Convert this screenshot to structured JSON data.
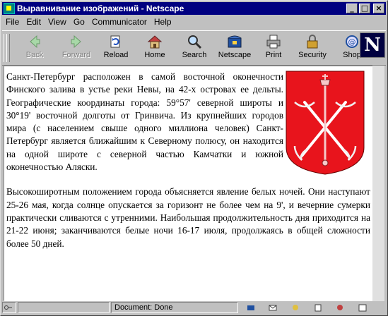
{
  "window": {
    "title": "Выравнивание изображений - Netscape",
    "minimize_glyph": "_",
    "maximize_glyph": "□",
    "close_glyph": "×"
  },
  "menu": [
    "File",
    "Edit",
    "View",
    "Go",
    "Communicator",
    "Help"
  ],
  "toolbar": {
    "buttons": [
      {
        "label": "Back",
        "icon": "back-arrow-icon",
        "enabled": false
      },
      {
        "label": "Forward",
        "icon": "forward-arrow-icon",
        "enabled": false
      },
      {
        "label": "Reload",
        "icon": "reload-icon",
        "enabled": true
      },
      {
        "label": "Home",
        "icon": "home-icon",
        "enabled": true
      },
      {
        "label": "Search",
        "icon": "search-icon",
        "enabled": true
      },
      {
        "label": "Netscape",
        "icon": "netscape-icon",
        "enabled": true
      },
      {
        "label": "Print",
        "icon": "print-icon",
        "enabled": true
      },
      {
        "label": "Security",
        "icon": "security-lock-icon",
        "enabled": true
      },
      {
        "label": "Shop",
        "icon": "shop-icon",
        "enabled": true
      }
    ],
    "logo_letter": "N"
  },
  "content": {
    "paragraph1": "Санкт-Петербург расположен в самой восточной оконечности Финского залива в устье реки Невы, на 42-х островах ее дельты. Географические координаты города: 59°57' северной широты и 30°19' восточной долготы от Гринвича. Из крупнейших городов мира (с населением свыше одного миллиона человек) Санкт-Петербург является ближайшим к Северному полюсу, он находится на одной широте с северной частью Камчатки и южной оконечностью Аляски.",
    "paragraph2": "Высокоширотным положением города объясняется явление белых ночей. Они наступают 25-26 мая, когда солнце опускается за горизонт не более чем на 9', и вечерние сумерки практически сливаются с утренними. Наибольшая продолжительность дня приходится на 21-22 июня; заканчиваются белые ночи 16-17 июля, продолжаясь в общей сложности более 50 дней.",
    "image": "saint-petersburg-coat-of-arms"
  },
  "status": {
    "text": "Document: Done"
  },
  "colors": {
    "titlebar": "#000080",
    "crest_red": "#e8141c"
  }
}
